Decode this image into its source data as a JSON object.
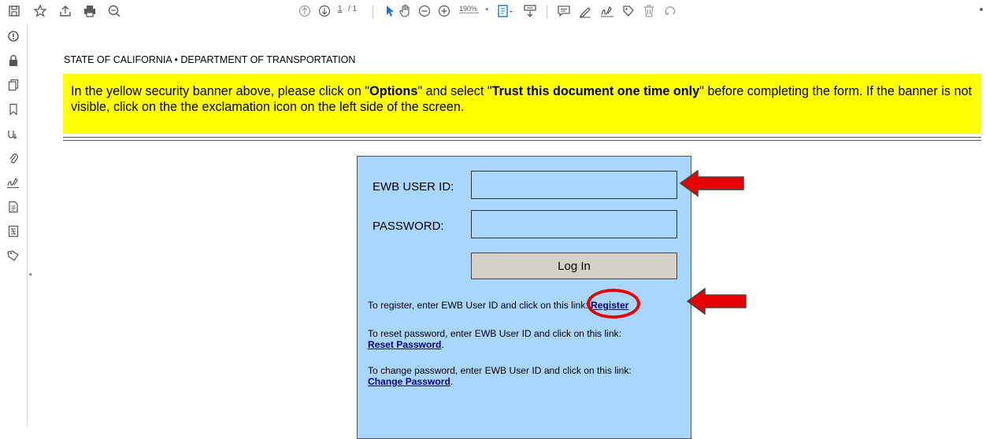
{
  "toolbar": {
    "page_current": "1",
    "page_total": "/ 1",
    "zoom": "190%",
    "icons": [
      "save-icon",
      "bookmark-star-icon",
      "share-icon",
      "print-icon",
      "zoom-search-icon",
      "page-up-icon",
      "page-down-icon",
      "select-cursor-icon",
      "hand-icon",
      "zoom-out-icon",
      "zoom-in-icon",
      "fit-page-icon",
      "scroll-mode-icon",
      "comment-icon",
      "highlight-pen-icon",
      "sign-icon",
      "stamp-icon",
      "delete-icon",
      "undo-icon"
    ]
  },
  "leftrail": {
    "icons": [
      "exclamation-icon",
      "lock-icon",
      "pages-icon",
      "bookmark-icon",
      "signature-panel-icon",
      "attachment-icon",
      "sign-pen-icon",
      "document-icon",
      "form-icon",
      "tag-icon"
    ]
  },
  "document": {
    "agency": "STATE OF CALIFORNIA • DEPARTMENT OF TRANSPORTATION",
    "banner": {
      "text_1": "In the yellow security banner above, please click on \"",
      "bold_1": "Options",
      "text_2": "\" and select \"",
      "bold_2": "Trust this document one time only",
      "text_3": "\" before completing the form. If the banner is not visible, click on the the exclamation icon on the left side of the screen."
    },
    "login": {
      "user_label": "EWB USER ID:",
      "password_label": "PASSWORD:",
      "button_label": "Log In",
      "register_text": "To register, enter EWB User ID and click on this link:",
      "register_link": "Register",
      "reset_text": "To reset password, enter EWB User ID and click on this link:",
      "reset_link": "Reset Password",
      "change_text": "To change password, enter EWB User ID and click on this link:",
      "change_link": "Change Password",
      "period": "."
    }
  },
  "colors": {
    "banner": "#ffff00",
    "panel": "#a9d6ff",
    "annotation_red": "#e60000",
    "link": "#00007f"
  }
}
